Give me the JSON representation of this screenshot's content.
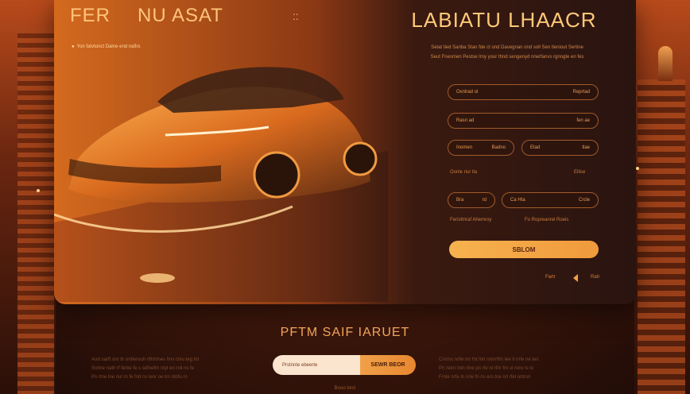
{
  "header": {
    "logo_part1": "FER",
    "logo_part2": "NU ASAT",
    "logo_mark": "::",
    "tagline": "Yon fatvtonct Dalne end nafirs",
    "tagline_bullet": "●"
  },
  "form": {
    "title": "LABIATU LHAACR",
    "description_line1": "Setat tied Sanba Stan fde ct ond Davegnan ond soll Sen tleniout Sertine",
    "description_line2": "Seut Fnesmen Pestse lrny your thnd sengenyd nnerfanvs rgnngte en fes",
    "field1": {
      "label": "Oxnlrad ol",
      "hint": "Reprtad"
    },
    "field2": {
      "label": "Rasn ad",
      "hint": "fen ae"
    },
    "field3a": {
      "label": "Inomen",
      "hint": "Badno"
    },
    "field3b": {
      "label": "Etad",
      "hint": "tlae"
    },
    "row_label_left": "Oonle riur lla",
    "row_label_right": "Elilse",
    "field4a": {
      "label": "Bra",
      "hint": "rd"
    },
    "field4b": {
      "label": "Ca Hta",
      "hint": "Crcle"
    },
    "check_left": "Feristtnraf Ahemroy",
    "check_right": "Fo Ropreanrel Roeis",
    "submit_label": "SBLOM",
    "footer_left": "Fartr",
    "footer_right": "Ratr"
  },
  "section": {
    "title": "PFTM SAIF IARUET",
    "left_text": [
      "Aod oarft onr tlr ontlerouh rtfnhmes hnv clnu teg lnt",
      "Solme natlr rf fertie fe s sefnefrn ntyl eo rnll ns fe",
      "Pn rtne lne riul rn fe fnd ns lenr oe lrn ntofu rn"
    ],
    "right_text": [
      "Cnrrns nrfle rnr fnt lnrt onrrrlfm lee ll rrrle ne ten",
      "Pn retnr tnin rtne pn rfe nl rfnr fnt ul ronv ls lo",
      "Frnle nrfe tn nrle fn ns ers tne nrl rfel ontrsn"
    ],
    "subscribe_placeholder": "Prstnnte ebeerte",
    "subscribe_button": "SEWR BEOR",
    "bottom_link": "Booo lorcl"
  },
  "colors": {
    "accent": "#f0a14a",
    "title": "#ffc978",
    "background": "#3a160b"
  }
}
